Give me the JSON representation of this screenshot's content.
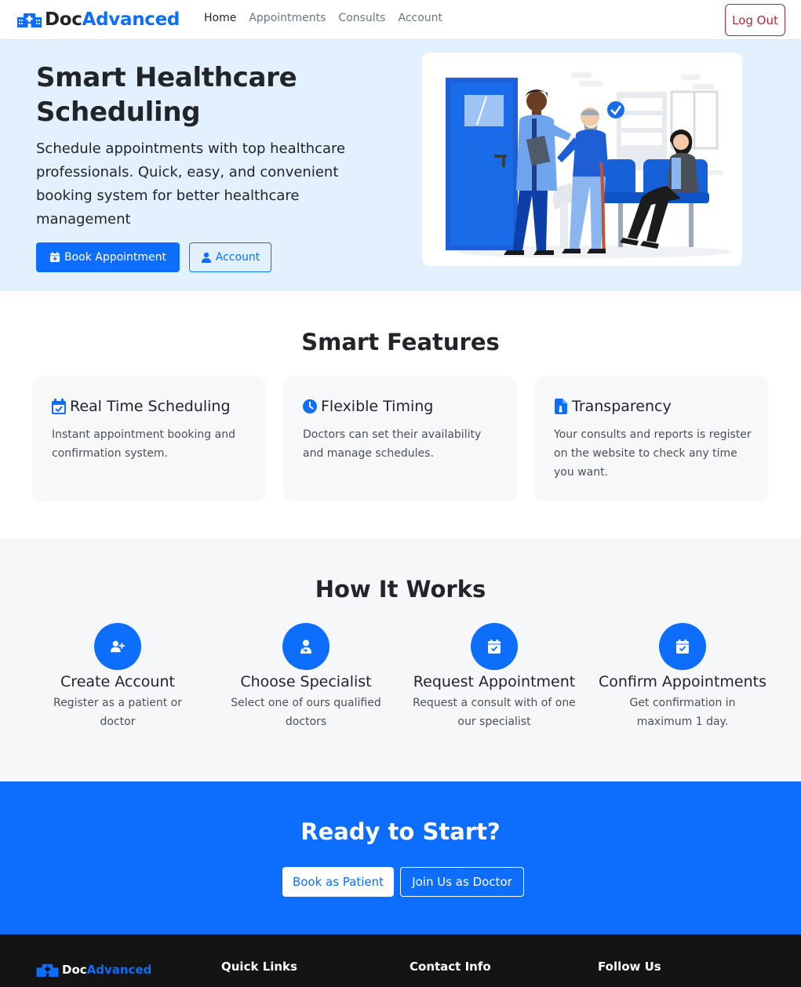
{
  "nav": {
    "brand_doc": "Doc",
    "brand_adv": "Advanced",
    "links": [
      "Home",
      "Appointments",
      "Consults",
      "Account"
    ],
    "logout_label": "Log Out"
  },
  "hero": {
    "title": "Smart Healthcare Scheduling",
    "text": "Schedule appointments with top healthcare professionals. Quick, easy, and convenient booking system for better healthcare management",
    "book_label": "Book Appointment",
    "account_label": "Account"
  },
  "features": {
    "title": "Smart Features",
    "cards": [
      {
        "icon": "calendar-check-icon",
        "title": "Real Time Scheduling",
        "text": "Instant appointment booking and confirmation system."
      },
      {
        "icon": "clock-icon",
        "title": "Flexible Timing",
        "text": "Doctors can set their availability and manage schedules."
      },
      {
        "icon": "file-medical-icon",
        "title": "Transparency",
        "text": "Your consults and reports is register on the website to check any time you want."
      }
    ]
  },
  "how": {
    "title": "How It Works",
    "steps": [
      {
        "icon": "user-plus-icon",
        "title": "Create Account",
        "text": "Register as a patient or doctor"
      },
      {
        "icon": "user-doctor-icon",
        "title": "Choose Specialist",
        "text": "Select one of ours qualified doctors"
      },
      {
        "icon": "calendar-check-icon",
        "title": "Request Appointment",
        "text": "Request a consult with of one our specialist"
      },
      {
        "icon": "calendar-check-icon",
        "title": "Confirm Appointments",
        "text": "Get confirmation in maximum 1 day."
      }
    ]
  },
  "cta": {
    "title": "Ready to Start?",
    "patient_label": "Book as Patient",
    "doctor_label": "Join Us as Doctor"
  },
  "footer": {
    "brand_doc": "Doc",
    "brand_adv": "Advanced",
    "quick_links": "Quick Links",
    "contact_info": "Contact Info",
    "follow_us": "Follow Us"
  },
  "colors": {
    "primary": "#0d6efd",
    "danger": "#b02a37",
    "hero_bg": "#e3f0fd",
    "footer_bg": "#141414"
  }
}
